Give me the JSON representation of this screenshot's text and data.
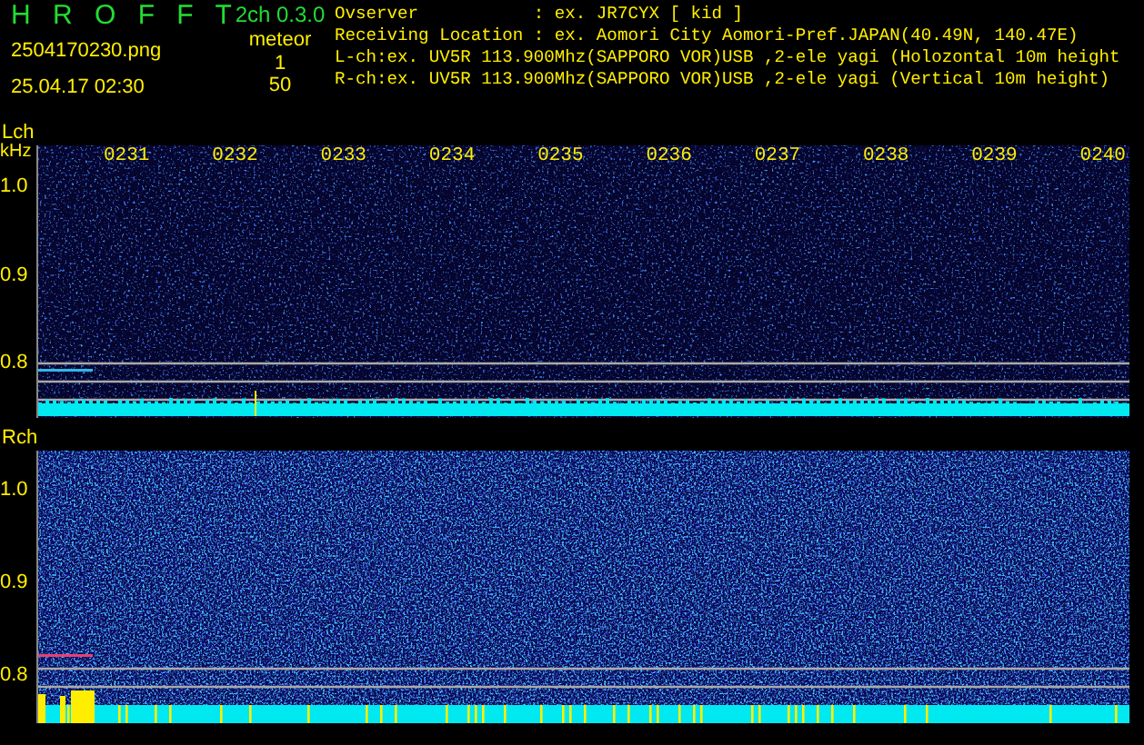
{
  "app": {
    "title": "H R O F F T",
    "version": "2ch 0.3.0"
  },
  "file": {
    "name": "2504170230.png",
    "datetime": "25.04.17 02:30"
  },
  "meteor": {
    "label": "meteor",
    "counts": [
      "1",
      "50"
    ]
  },
  "info": [
    "Ovserver           : ex. JR7CYX [ kid ]",
    "Receiving Location : ex. Aomori City Aomori-Pref.JAPAN(40.49N, 140.47E)",
    "L-ch:ex. UV5R 113.900Mhz(SAPPORO VOR)USB ,2-ele yagi (Holozontal 10m height",
    "R-ch:ex. UV5R 113.900Mhz(SAPPORO VOR)USB ,2-ele yagi (Vertical 10m height)"
  ],
  "time_labels": [
    "0231",
    "0232",
    "0233",
    "0234",
    "0235",
    "0236",
    "0237",
    "0238",
    "0239",
    "0240"
  ],
  "channels": [
    {
      "label": "Lch",
      "unit": "kHz",
      "yticks": [
        "1.0",
        "0.9",
        "0.8"
      ]
    },
    {
      "label": "Rch",
      "yticks": [
        "1.0",
        "0.9",
        "0.8"
      ]
    }
  ]
}
